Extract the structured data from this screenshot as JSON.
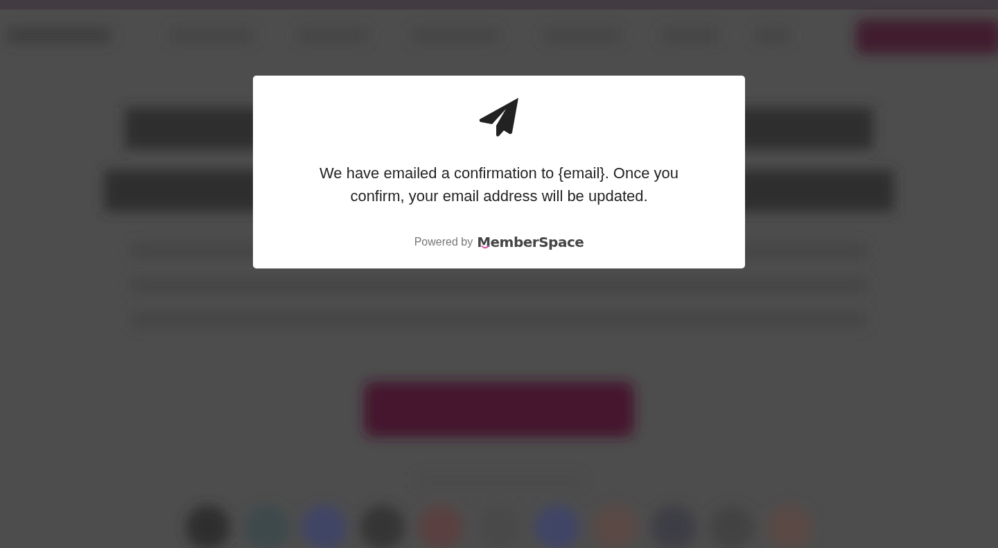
{
  "modal": {
    "message": "We have emailed a confirmation to {email}. Once you confirm, your email address will be updated.",
    "powered_by": "Powered by",
    "brand": "MemberSpace"
  }
}
